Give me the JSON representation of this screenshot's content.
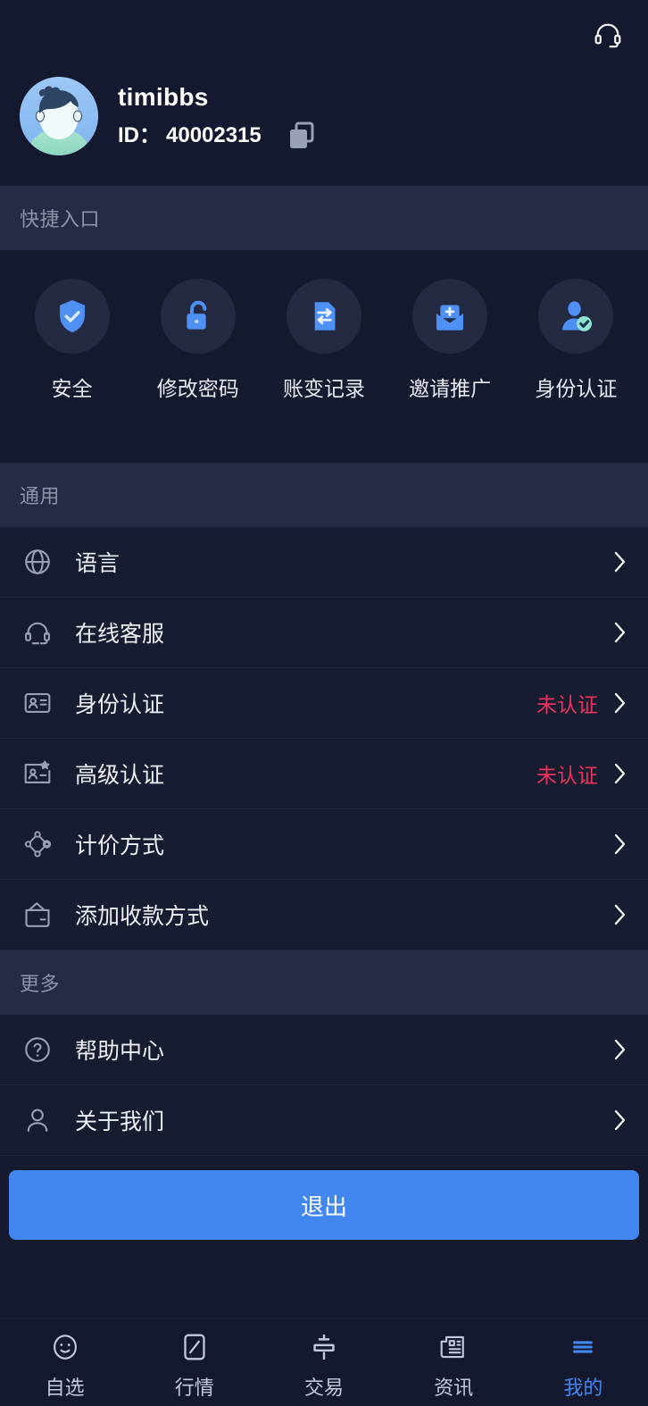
{
  "header": {
    "support_icon": "headset-icon",
    "username": "timibbs",
    "id_label": "ID：",
    "id_value": "40002315",
    "copy_icon": "copy-icon"
  },
  "quick_access": {
    "title": "快捷入口",
    "items": [
      {
        "label": "安全",
        "icon": "shield-check-icon"
      },
      {
        "label": "修改密码",
        "icon": "unlock-icon"
      },
      {
        "label": "账变记录",
        "icon": "transfer-record-icon"
      },
      {
        "label": "邀请推广",
        "icon": "invite-mail-icon"
      },
      {
        "label": "身份认证",
        "icon": "user-verified-icon"
      }
    ]
  },
  "general": {
    "title": "通用",
    "items": [
      {
        "label": "语言",
        "icon": "globe-icon",
        "value": ""
      },
      {
        "label": "在线客服",
        "icon": "headset-icon",
        "value": ""
      },
      {
        "label": "身份认证",
        "icon": "id-card-icon",
        "value": "未认证"
      },
      {
        "label": "高级认证",
        "icon": "id-card-star-icon",
        "value": "未认证"
      },
      {
        "label": "计价方式",
        "icon": "node-graph-icon",
        "value": ""
      },
      {
        "label": "添加收款方式",
        "icon": "wallet-icon",
        "value": ""
      }
    ]
  },
  "more": {
    "title": "更多",
    "items": [
      {
        "label": "帮助中心",
        "icon": "question-circle-icon",
        "value": ""
      },
      {
        "label": "关于我们",
        "icon": "person-icon",
        "value": ""
      }
    ]
  },
  "logout": {
    "label": "退出"
  },
  "tabbar": {
    "items": [
      {
        "label": "自选",
        "icon": "smiley-icon",
        "active": false
      },
      {
        "label": "行情",
        "icon": "market-chart-icon",
        "active": false
      },
      {
        "label": "交易",
        "icon": "candlestick-icon",
        "active": false
      },
      {
        "label": "资讯",
        "icon": "newspaper-icon",
        "active": false
      },
      {
        "label": "我的",
        "icon": "menu-lines-icon",
        "active": true
      }
    ]
  },
  "colors": {
    "background": "#151a2e",
    "section_header_bg": "#252a45",
    "accent_blue": "#4286f0",
    "warning_red": "#e8335e",
    "row_bg": "#171c30",
    "divider": "#232842"
  }
}
